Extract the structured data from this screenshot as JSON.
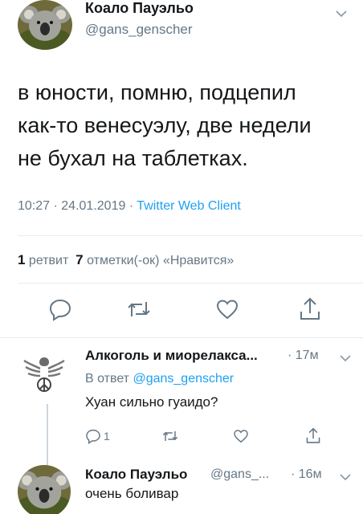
{
  "tweet": {
    "author": {
      "name": "Коало Пауэльо",
      "handle": "@gans_genscher",
      "avatar": "koala-avatar"
    },
    "text_lines": [
      "в юности, помню, подцепил",
      "как-то венесуэлу, две недели",
      "не бухал на таблетках."
    ],
    "time": "10:27",
    "separator": "·",
    "date": "24.01.2019",
    "client": "Twitter Web Client",
    "stats": {
      "retweets_count": "1",
      "retweets_label": "ретвит",
      "likes_count": "7",
      "likes_label": "отметки(-ок) «Нравится»"
    },
    "actions": [
      "reply-icon",
      "retweet-icon",
      "like-icon",
      "share-icon"
    ]
  },
  "replies": [
    {
      "name": "Алкоголь и миорелакса...",
      "time": "· 17м",
      "reply_to_label": "В ответ",
      "reply_to_handle": "@gans_genscher",
      "text": "Хуан сильно гуаидо?",
      "avatar": "eagle-emblem-avatar",
      "reply_count": "1"
    },
    {
      "name": "Коало Пауэльо",
      "handle": "@gans_...",
      "time": "· 16м",
      "text": "очень боливар",
      "avatar": "koala-avatar"
    }
  ],
  "colors": {
    "text": "#14171a",
    "secondary": "#657786",
    "link": "#1da1f2",
    "divider": "#e6ecf0"
  }
}
